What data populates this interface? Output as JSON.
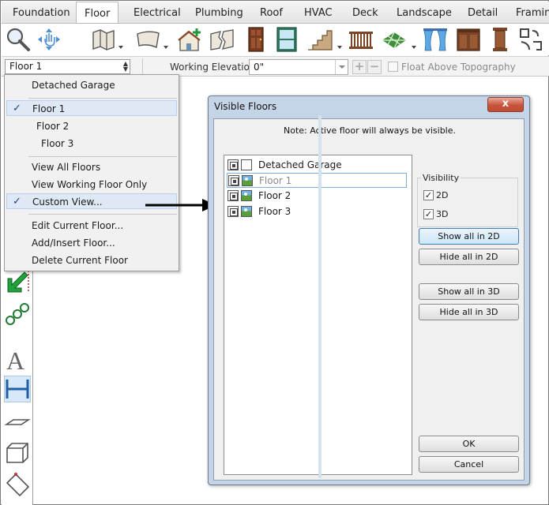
{
  "tabs": [
    {
      "label": "Foundation",
      "active": false
    },
    {
      "label": "Floor",
      "active": true
    },
    {
      "label": "Electrical",
      "active": false
    },
    {
      "label": "Plumbing",
      "active": false
    },
    {
      "label": "Roof",
      "active": false
    },
    {
      "label": "HVAC",
      "active": false
    },
    {
      "label": "Deck",
      "active": false
    },
    {
      "label": "Landscape",
      "active": false
    },
    {
      "label": "Detail",
      "active": false
    },
    {
      "label": "Framing",
      "active": false
    }
  ],
  "ribbon": {
    "icons": [
      "zoom-icon",
      "pan-icon",
      "floor-plan-icon",
      "curved-wall-icon",
      "add-floor-house-icon",
      "broken-wall-icon",
      "door-icon",
      "window-icon",
      "stairs-icon",
      "railing-icon",
      "floor-tile-icon",
      "curtain-icon",
      "cabinet-icon",
      "column-icon",
      "shape-icon"
    ]
  },
  "options_bar": {
    "floor_select_value": "Floor 1",
    "working_elevation_label": "Working Elevation:",
    "working_elevation_value": "0\"",
    "plus_label": "+",
    "minus_label": "−",
    "float_above_label": "Float Above Topography"
  },
  "floor_menu": {
    "items": [
      {
        "label": "Detached Garage",
        "checked": false
      },
      {
        "label": "Floor 1",
        "checked": true
      },
      {
        "label": "Floor 2",
        "checked": false
      },
      {
        "label": "Floor 3",
        "checked": false
      },
      {
        "label": "View All Floors",
        "checked": false
      },
      {
        "label": "View Working Floor Only",
        "checked": false
      },
      {
        "label": "Custom View...",
        "checked": true
      },
      {
        "label": "Edit Current Floor...",
        "checked": false
      },
      {
        "label": "Add/Insert Floor...",
        "checked": false
      },
      {
        "label": "Delete Current Floor",
        "checked": false
      }
    ],
    "check_glyph": "✓"
  },
  "dialog": {
    "title": "Visible Floors",
    "close_glyph": "x",
    "note": "Note: Active floor will always be visible.",
    "floors": [
      {
        "name": "Detached Garage",
        "visible_3d": false,
        "selected": false
      },
      {
        "name": "Floor 1",
        "visible_3d": true,
        "selected": true
      },
      {
        "name": "Floor 2",
        "visible_3d": true,
        "selected": false
      },
      {
        "name": "Floor 3",
        "visible_3d": true,
        "selected": false
      }
    ],
    "visibility": {
      "title": "Visibility",
      "option_2d_label": "2D",
      "option_2d_checked": true,
      "option_3d_label": "3D",
      "option_3d_checked": true
    },
    "buttons": {
      "show_all_2d": "Show all in 2D",
      "hide_all_2d": "Hide all in 2D",
      "show_all_3d": "Show all in 3D",
      "hide_all_3d": "Hide all in 3D",
      "ok": "OK",
      "cancel": "Cancel"
    }
  },
  "colors": {
    "dialog_frame": "#c5d5e7",
    "close_button": "#c8533c",
    "menu_highlight": "#dfe9f6",
    "check_mark": "#1c3f84"
  }
}
